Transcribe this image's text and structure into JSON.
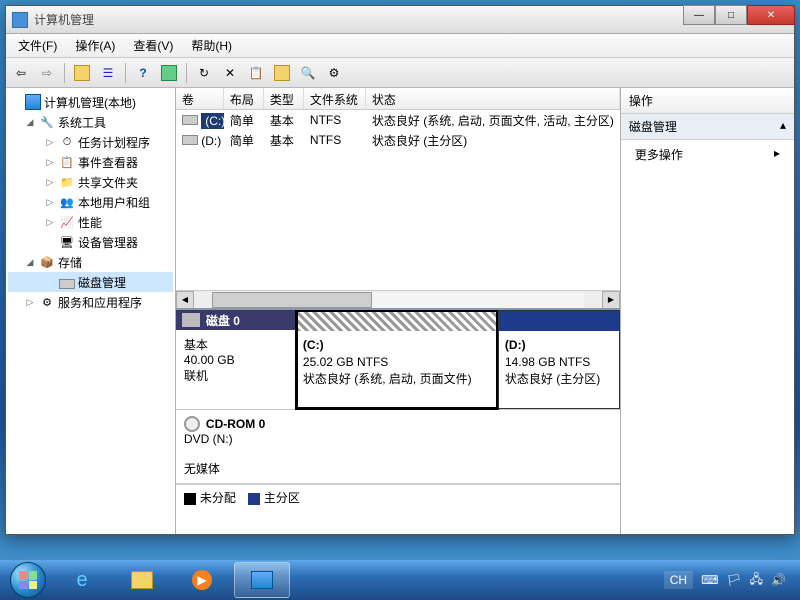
{
  "window": {
    "title": "计算机管理"
  },
  "menu": {
    "file": "文件(F)",
    "action": "操作(A)",
    "view": "查看(V)",
    "help": "帮助(H)"
  },
  "tree": {
    "root": "计算机管理(本地)",
    "sysTools": "系统工具",
    "items": {
      "taskScheduler": "任务计划程序",
      "eventViewer": "事件查看器",
      "sharedFolders": "共享文件夹",
      "localUsers": "本地用户和组",
      "performance": "性能",
      "deviceManager": "设备管理器"
    },
    "storage": "存储",
    "diskMgmt": "磁盘管理",
    "services": "服务和应用程序"
  },
  "volumes": {
    "headers": {
      "vol": "卷",
      "layout": "布局",
      "type": "类型",
      "fs": "文件系统",
      "status": "状态"
    },
    "rows": [
      {
        "name": "(C:)",
        "layout": "简单",
        "type": "基本",
        "fs": "NTFS",
        "status": "状态良好 (系统, 启动, 页面文件, 活动, 主分区)"
      },
      {
        "name": "(D:)",
        "layout": "简单",
        "type": "基本",
        "fs": "NTFS",
        "status": "状态良好 (主分区)"
      }
    ]
  },
  "disks": {
    "disk0": {
      "title": "磁盘 0",
      "type": "基本",
      "size": "40.00 GB",
      "state": "联机"
    },
    "partC": {
      "name": "(C:)",
      "sizefs": "25.02 GB NTFS",
      "status": "状态良好 (系统, 启动, 页面文件)"
    },
    "partD": {
      "name": "(D:)",
      "sizefs": "14.98 GB NTFS",
      "status": "状态良好 (主分区)"
    },
    "cdrom": {
      "title": "CD-ROM 0",
      "type": "DVD (N:)",
      "state": "无媒体"
    }
  },
  "legend": {
    "unalloc": "未分配",
    "primary": "主分区"
  },
  "actions": {
    "header": "操作",
    "section": "磁盘管理",
    "more": "更多操作"
  },
  "tray": {
    "lang": "CH"
  }
}
